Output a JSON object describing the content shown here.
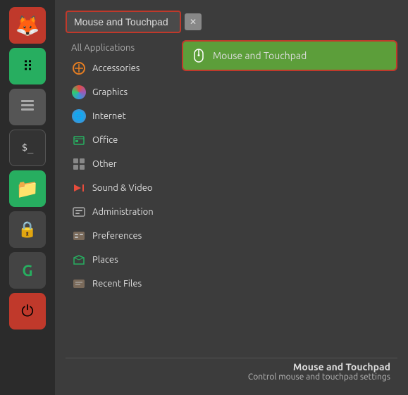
{
  "taskbar": {
    "icons": [
      {
        "name": "firefox",
        "symbol": "🦊",
        "class": "firefox"
      },
      {
        "name": "grid",
        "symbol": "⊞",
        "class": "grid"
      },
      {
        "name": "switcher",
        "symbol": "≡",
        "class": "switcher"
      },
      {
        "name": "terminal",
        "symbol": "$_",
        "class": "terminal"
      },
      {
        "name": "files",
        "symbol": "📁",
        "class": "files"
      },
      {
        "name": "lock",
        "symbol": "🔒",
        "class": "lock"
      },
      {
        "name": "grammarly",
        "symbol": "G",
        "class": "grammarly"
      },
      {
        "name": "power",
        "symbol": "⏻",
        "class": "power"
      }
    ]
  },
  "search": {
    "value": "Mouse and Touchpad",
    "placeholder": "Mouse and Touchpad",
    "clear_label": "✕"
  },
  "categories": {
    "all_label": "All Applications",
    "items": [
      {
        "label": "Accessories",
        "icon": "🔧"
      },
      {
        "label": "Graphics",
        "icon": "graphics"
      },
      {
        "label": "Internet",
        "icon": "🌐"
      },
      {
        "label": "Office",
        "icon": "📊"
      },
      {
        "label": "Other",
        "icon": "⋯"
      },
      {
        "label": "Sound & Video",
        "icon": "▶"
      },
      {
        "label": "Administration",
        "icon": "🖥"
      },
      {
        "label": "Preferences",
        "icon": "🗃"
      },
      {
        "label": "Places",
        "icon": "📁"
      },
      {
        "label": "Recent Files",
        "icon": "🗃"
      }
    ]
  },
  "results": {
    "items": [
      {
        "label": "Mouse and Touchpad",
        "active": true
      }
    ]
  },
  "status": {
    "app_name": "Mouse and Touchpad",
    "app_desc": "Control mouse and touchpad settings"
  }
}
